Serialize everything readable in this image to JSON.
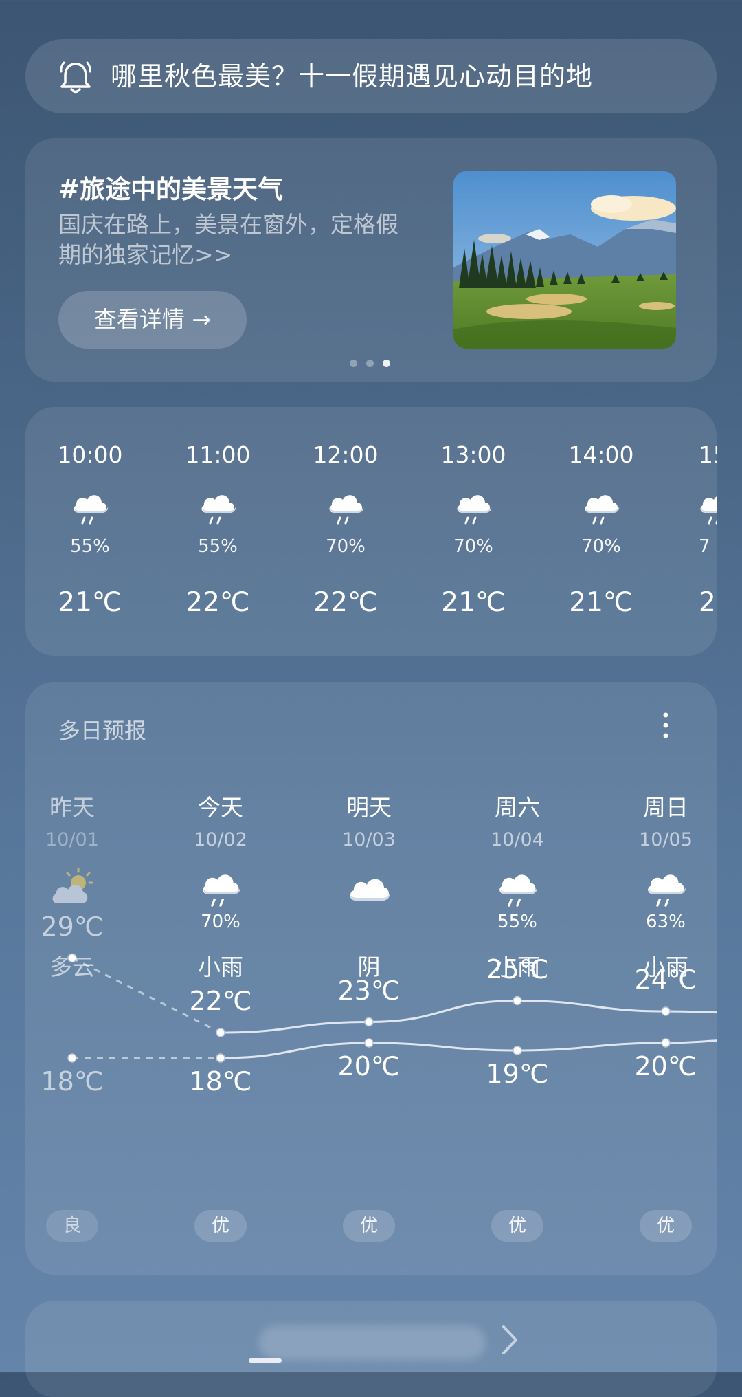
{
  "banner": {
    "text": "哪里秋色最美？十一假期遇见心动目的地",
    "icon": "bell-icon"
  },
  "feature": {
    "title": "#旅途中的美景天气",
    "description": "国庆在路上，美景在窗外，定格假期的独家记忆>>",
    "button_label": "查看详情 →",
    "carousel": {
      "count": 3,
      "active": 3
    }
  },
  "hourly": [
    {
      "time": "10:00",
      "icon": "rain-cloud-icon",
      "precip": "55%",
      "temp": "21℃"
    },
    {
      "time": "11:00",
      "icon": "rain-cloud-icon",
      "precip": "55%",
      "temp": "22℃"
    },
    {
      "time": "12:00",
      "icon": "rain-cloud-icon",
      "precip": "70%",
      "temp": "22℃"
    },
    {
      "time": "13:00",
      "icon": "rain-cloud-icon",
      "precip": "70%",
      "temp": "21℃"
    },
    {
      "time": "14:00",
      "icon": "rain-cloud-icon",
      "precip": "70%",
      "temp": "21℃"
    },
    {
      "time": "15",
      "icon": "rain-cloud-icon",
      "precip": "7",
      "temp": "2"
    }
  ],
  "daily": {
    "title": "多日预报",
    "days": [
      {
        "name": "昨天",
        "date": "10/01",
        "icon": "partly-cloudy-icon",
        "precip": "",
        "cond": "多云",
        "high": "29℃",
        "low": "18℃",
        "high_value": 29,
        "low_value": 18,
        "aqi": "良",
        "past": true
      },
      {
        "name": "今天",
        "date": "10/02",
        "icon": "rain-cloud-icon",
        "precip": "70%",
        "cond": "小雨",
        "high": "22℃",
        "low": "18℃",
        "high_value": 22,
        "low_value": 18,
        "aqi": "优",
        "past": false
      },
      {
        "name": "明天",
        "date": "10/03",
        "icon": "cloud-icon",
        "precip": "",
        "cond": "阴",
        "high": "23℃",
        "low": "20℃",
        "high_value": 23,
        "low_value": 20,
        "aqi": "优",
        "past": false
      },
      {
        "name": "周六",
        "date": "10/04",
        "icon": "rain-cloud-icon",
        "precip": "55%",
        "cond": "小雨",
        "high": "25℃",
        "low": "19℃",
        "high_value": 25,
        "low_value": 19,
        "aqi": "优",
        "past": false
      },
      {
        "name": "周日",
        "date": "10/05",
        "icon": "rain-cloud-icon",
        "precip": "63%",
        "cond": "小雨",
        "high": "24℃",
        "low": "20℃",
        "high_value": 24,
        "low_value": 20,
        "aqi": "优",
        "past": false
      }
    ]
  },
  "colors": {
    "background_top": "#3c5573",
    "background_bottom": "#6484a9",
    "curve": "#dfe6f0"
  }
}
